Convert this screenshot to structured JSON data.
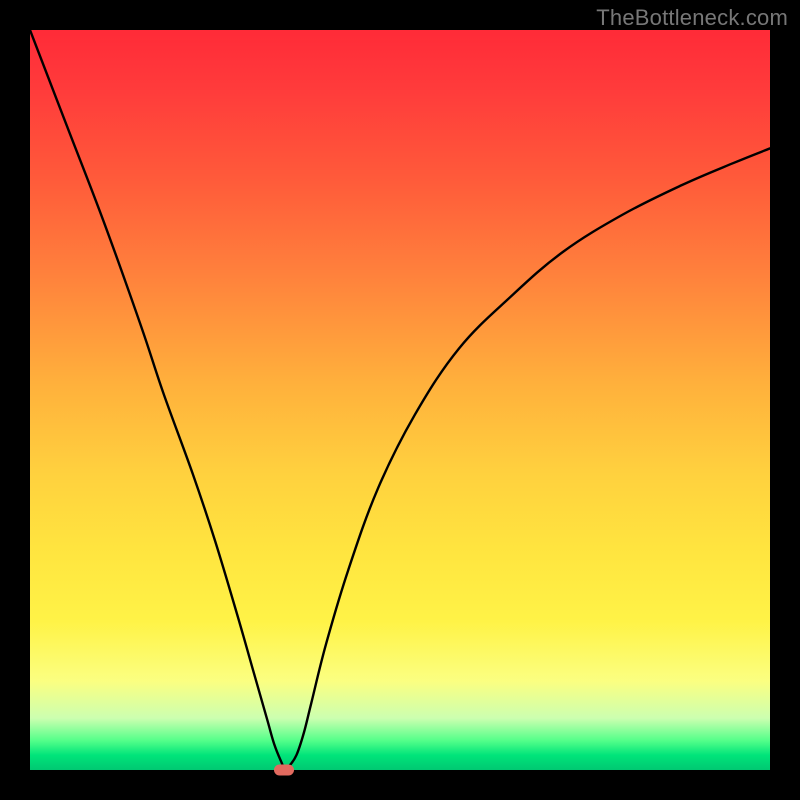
{
  "watermark": "TheBottleneck.com",
  "colors": {
    "frame": "#000000",
    "curve": "#000000",
    "marker": "#e26a5f",
    "gradient_top": "#ff2b38",
    "gradient_bottom": "#00c872"
  },
  "chart_data": {
    "type": "line",
    "title": "",
    "xlabel": "",
    "ylabel": "",
    "xlim": [
      0,
      100
    ],
    "ylim": [
      0,
      100
    ],
    "grid": false,
    "legend": false,
    "series": [
      {
        "name": "bottleneck-curve",
        "x": [
          0,
          5,
          10,
          15,
          18,
          22,
          25,
          28,
          30,
          32,
          33,
          34,
          34.5,
          35,
          36,
          37,
          38,
          40,
          43,
          47,
          52,
          58,
          65,
          72,
          80,
          88,
          95,
          100
        ],
        "y": [
          100,
          87,
          74,
          60,
          51,
          40,
          31,
          21,
          14,
          7,
          3.5,
          1,
          0,
          0.5,
          2,
          5,
          9,
          17,
          27,
          38,
          48,
          57,
          64,
          70,
          75,
          79,
          82,
          84
        ]
      }
    ],
    "annotations": [
      {
        "name": "optimal-point-marker",
        "x": 34.3,
        "y": 0
      }
    ]
  }
}
